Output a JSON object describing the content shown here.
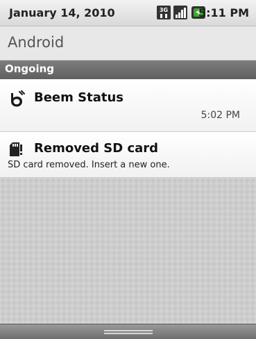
{
  "status_bar": {
    "date": "January 14, 2010",
    "time": "5:11 PM",
    "icons": [
      "3g-icon",
      "signal-strength-icon",
      "battery-charging-icon"
    ],
    "network_label": "3G"
  },
  "carrier": {
    "label": "Android"
  },
  "section": {
    "label": "Ongoing"
  },
  "notifications": [
    {
      "icon": "beem-icon",
      "title": "Beem Status",
      "time": "5:02 PM"
    },
    {
      "icon": "sd-card-icon",
      "title": "Removed SD card",
      "text": "SD card removed. Insert a new one."
    }
  ],
  "colors": {
    "section_header": "#6b6b6b",
    "battery_accent": "#3fa535",
    "background_empty": "#c8c8c8"
  }
}
